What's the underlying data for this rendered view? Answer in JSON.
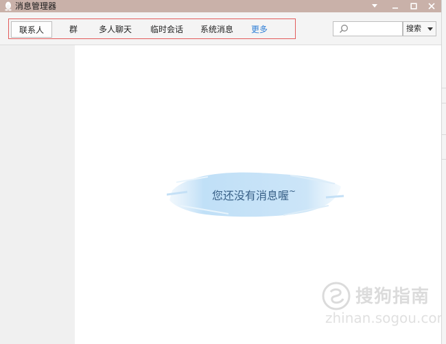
{
  "window": {
    "title": "消息管理器",
    "controls": [
      "dropdown",
      "minimize",
      "maximize",
      "close"
    ]
  },
  "toolbar": {
    "tabs": [
      {
        "label": "联系人",
        "selected": true
      },
      {
        "label": "群"
      },
      {
        "label": "多人聊天"
      },
      {
        "label": "临时会话"
      },
      {
        "label": "系统消息"
      },
      {
        "label": "更多"
      }
    ],
    "search": {
      "placeholder": "",
      "value": ""
    },
    "search_button_label": "搜索"
  },
  "main": {
    "empty_message": "您还没有消息喔",
    "empty_tilde": "~"
  },
  "watermark": {
    "text": "搜狗指南",
    "url": "zhinan.sogou.com"
  },
  "colors": {
    "titlebar": "#c9b1a9",
    "highlight_outline": "#e25a5a",
    "more_link": "#2f7fd6",
    "empty_text": "#375f86"
  }
}
